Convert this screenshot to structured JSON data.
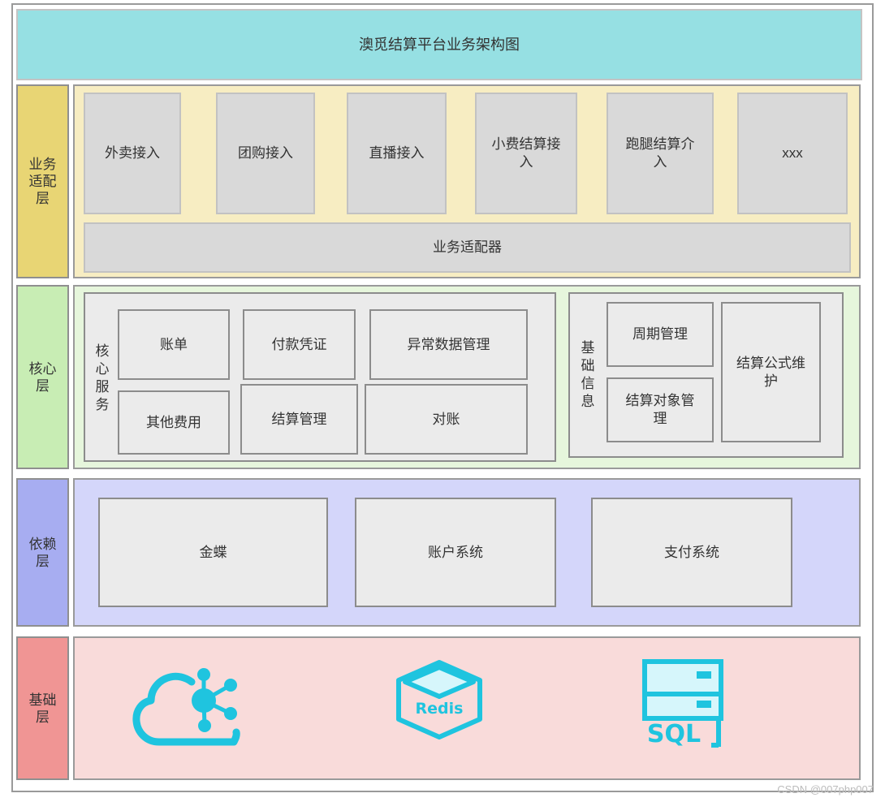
{
  "title": "澳觅结算平台业务架构图",
  "layers": {
    "business": {
      "label": "业务适配层",
      "items": [
        "外卖接入",
        "团购接入",
        "直播接入",
        "小费结算接入",
        "跑腿结算介入",
        "xxx"
      ],
      "adapter": "业务适配器"
    },
    "core": {
      "label": "核心层",
      "core_group_label": "核心服务",
      "core_items": [
        "账单",
        "付款凭证",
        "异常数据管理",
        "其他费用",
        "结算管理",
        "对账"
      ],
      "base_group_label": "基础信息",
      "base_items": [
        "周期管理",
        "结算对象管理",
        "结算公式维护"
      ]
    },
    "dependency": {
      "label": "依赖层",
      "items": [
        "金蝶",
        "账户系统",
        "支付系统"
      ]
    },
    "foundation": {
      "label": "基础层",
      "icons": [
        "cloud-network-icon",
        "redis-icon",
        "sql-database-icon"
      ],
      "redis_text": "Redis",
      "sql_text": "SQL",
      "icon_color": "#1fc4df"
    }
  },
  "watermark": "CSDN @007php007"
}
